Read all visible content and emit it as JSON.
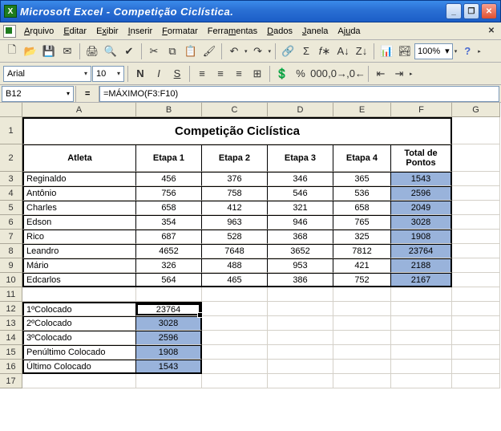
{
  "titlebar": {
    "app_name": "Microsoft Excel",
    "doc_name": "Competição Ciclística."
  },
  "menu": {
    "arquivo": "Arquivo",
    "editar": "Editar",
    "exibir": "Exibir",
    "inserir": "Inserir",
    "formatar": "Formatar",
    "ferramentas": "Ferramentas",
    "dados": "Dados",
    "janela": "Janela",
    "ajuda": "Ajuda"
  },
  "toolbar": {
    "zoom": "100%"
  },
  "fmtbar": {
    "font": "Arial",
    "size": "10"
  },
  "formulabar": {
    "cellref": "B12",
    "eq": "=",
    "formula": "=MÁXIMO(F3:F10)"
  },
  "columns": [
    "A",
    "B",
    "C",
    "D",
    "E",
    "F",
    "G"
  ],
  "rows": [
    "1",
    "2",
    "3",
    "4",
    "5",
    "6",
    "7",
    "8",
    "9",
    "10",
    "11",
    "12",
    "13",
    "14",
    "15",
    "16",
    "17"
  ],
  "table": {
    "title": "Competição Ciclística",
    "headers": {
      "atleta": "Atleta",
      "etapa1": "Etapa 1",
      "etapa2": "Etapa 2",
      "etapa3": "Etapa 3",
      "etapa4": "Etapa 4",
      "total": "Total de Pontos"
    },
    "data": [
      {
        "name": "Reginaldo",
        "e1": "456",
        "e2": "376",
        "e3": "346",
        "e4": "365",
        "total": "1543"
      },
      {
        "name": "Antônio",
        "e1": "756",
        "e2": "758",
        "e3": "546",
        "e4": "536",
        "total": "2596"
      },
      {
        "name": "Charles",
        "e1": "658",
        "e2": "412",
        "e3": "321",
        "e4": "658",
        "total": "2049"
      },
      {
        "name": "Edson",
        "e1": "354",
        "e2": "963",
        "e3": "946",
        "e4": "765",
        "total": "3028"
      },
      {
        "name": "Rico",
        "e1": "687",
        "e2": "528",
        "e3": "368",
        "e4": "325",
        "total": "1908"
      },
      {
        "name": "Leandro",
        "e1": "4652",
        "e2": "7648",
        "e3": "3652",
        "e4": "7812",
        "total": "23764"
      },
      {
        "name": "Mário",
        "e1": "326",
        "e2": "488",
        "e3": "953",
        "e4": "421",
        "total": "2188"
      },
      {
        "name": "Edcarlos",
        "e1": "564",
        "e2": "465",
        "e3": "386",
        "e4": "752",
        "total": "2167"
      }
    ],
    "rankings": [
      {
        "label": "1ºColocado",
        "value": "23764"
      },
      {
        "label": "2ºColocado",
        "value": "3028"
      },
      {
        "label": "3ºColocado",
        "value": "2596"
      },
      {
        "label": "Penúltimo Colocado",
        "value": "1908"
      },
      {
        "label": "Último Colocado",
        "value": "1543"
      }
    ]
  }
}
